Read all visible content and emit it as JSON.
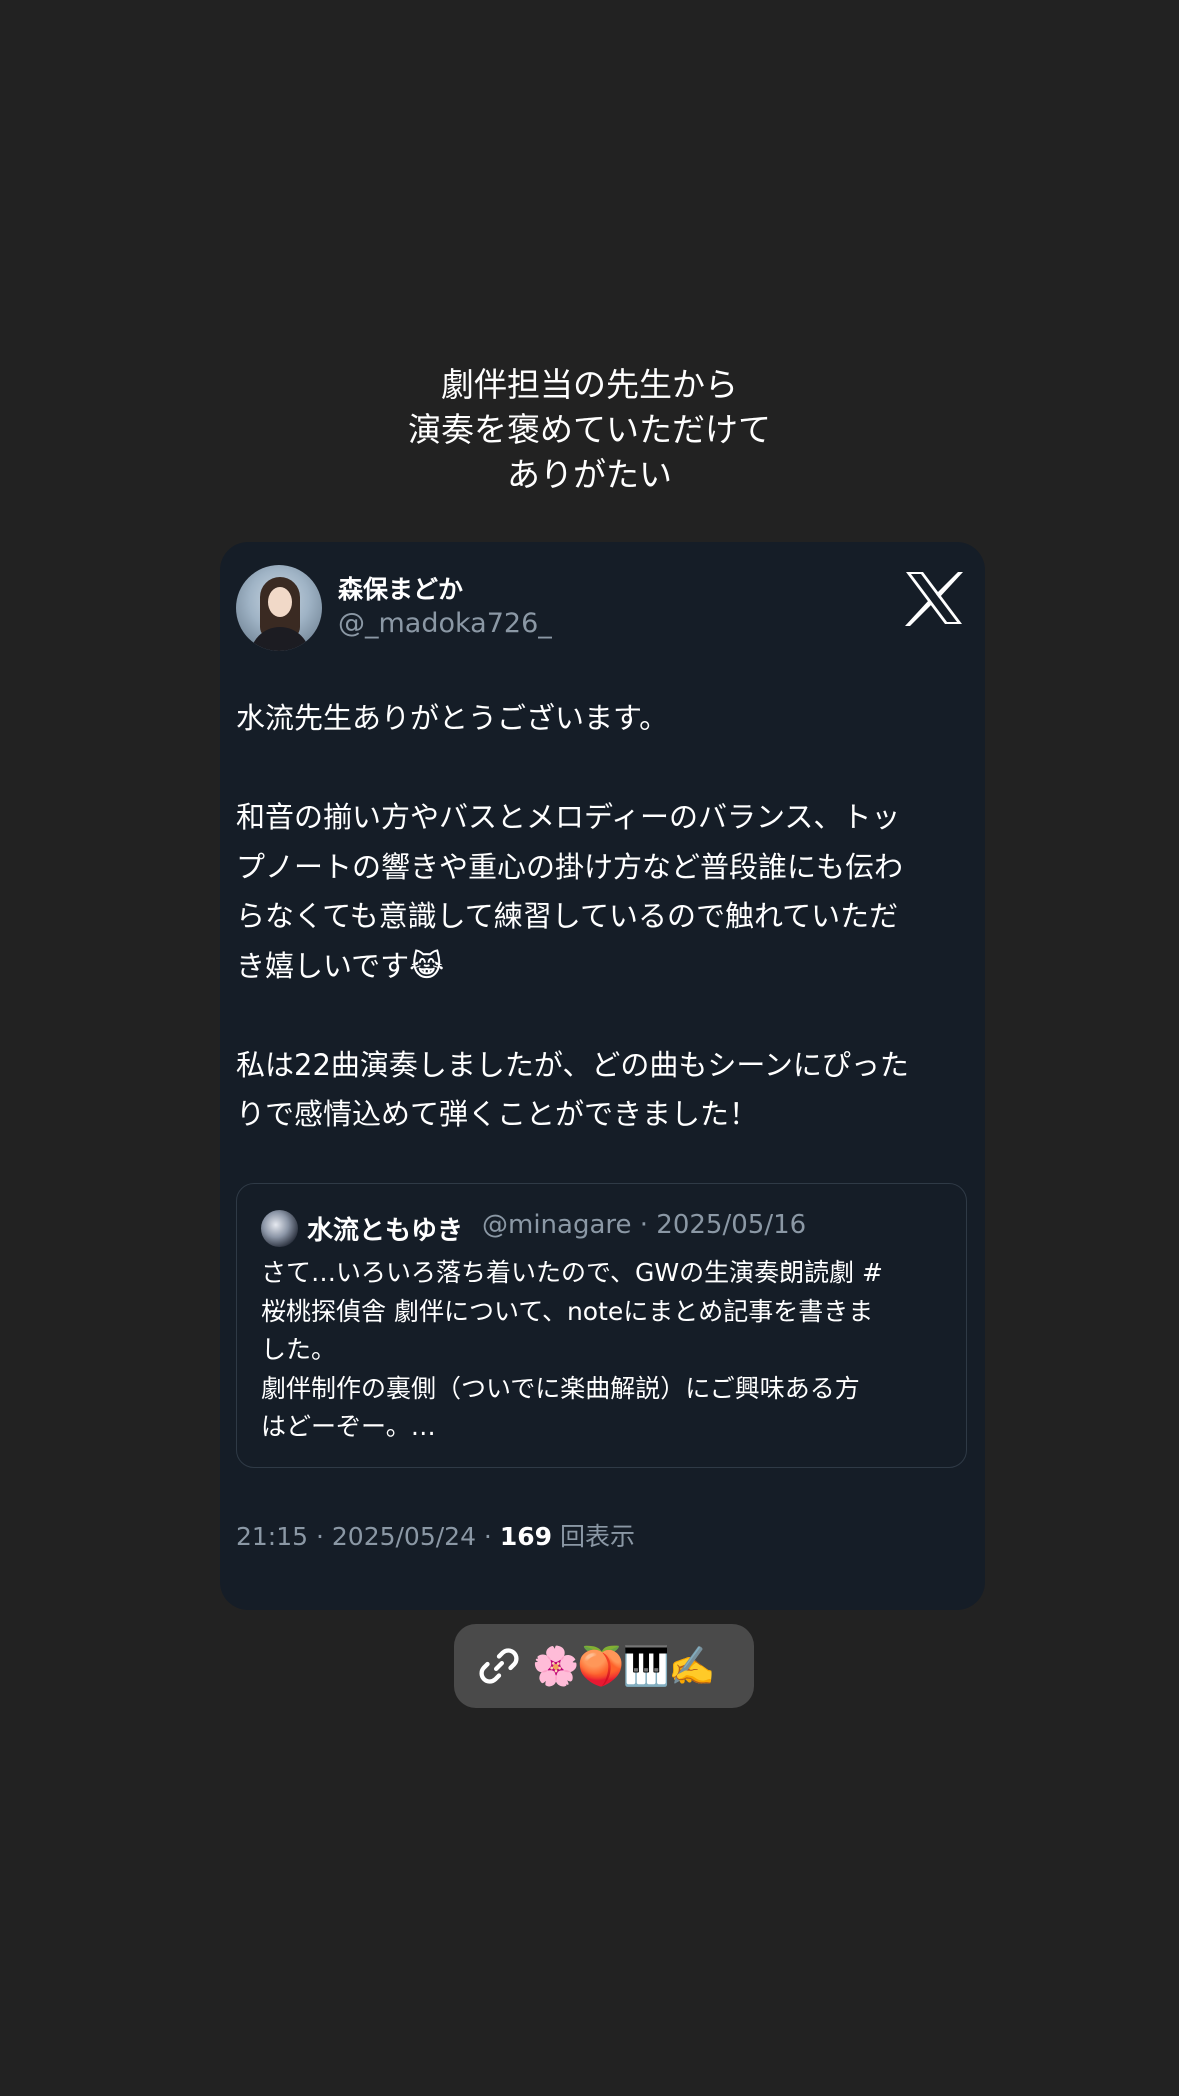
{
  "caption": {
    "line1": "劇伴担当の先生から",
    "line2": "演奏を褒めていただけて",
    "line3": "ありがたい"
  },
  "post": {
    "user_name": "森保まどか",
    "user_handle": "@_madoka726_",
    "platform_icon": "x-logo-icon",
    "body": {
      "p1": "水流先生ありがとうございます。",
      "p2_l1": "和音の揃い方やバスとメロディーのバランス、トッ",
      "p2_l2": "プノートの響きや重心の掛け方など普段誰にも伝わ",
      "p2_l3": "らなくても意識して練習しているので触れていただ",
      "p2_l4": "き嬉しいです",
      "p2_emoji": "😹",
      "p3_l1": "私は22曲演奏しましたが、どの曲もシーンにぴった",
      "p3_l2": "りで感情込めて弾くことができました！"
    },
    "quote": {
      "name": "水流ともゆき",
      "meta": "@minagare · 2025/05/16",
      "l1": "さて…いろいろ落ち着いたので、GWの生演奏朗読劇 #",
      "l2": "桜桃探偵舎 劇伴について、noteにまとめ記事を書きま",
      "l3": "した。",
      "l4": "劇伴制作の裏側（ついでに楽曲解説）にご興味ある方",
      "l5": "はどーぞー。…"
    },
    "footer": {
      "time": "21:15 · 2025/05/24 · ",
      "views_count": "169",
      "views_label": " 回表示"
    }
  },
  "link_sticker": {
    "icon": "link-icon",
    "emojis": "🌸🍑🎹✍️"
  },
  "colors": {
    "background": "#222222",
    "card": "#151d27",
    "muted_text": "#8b98a5",
    "pill": "#4a4a4a"
  }
}
